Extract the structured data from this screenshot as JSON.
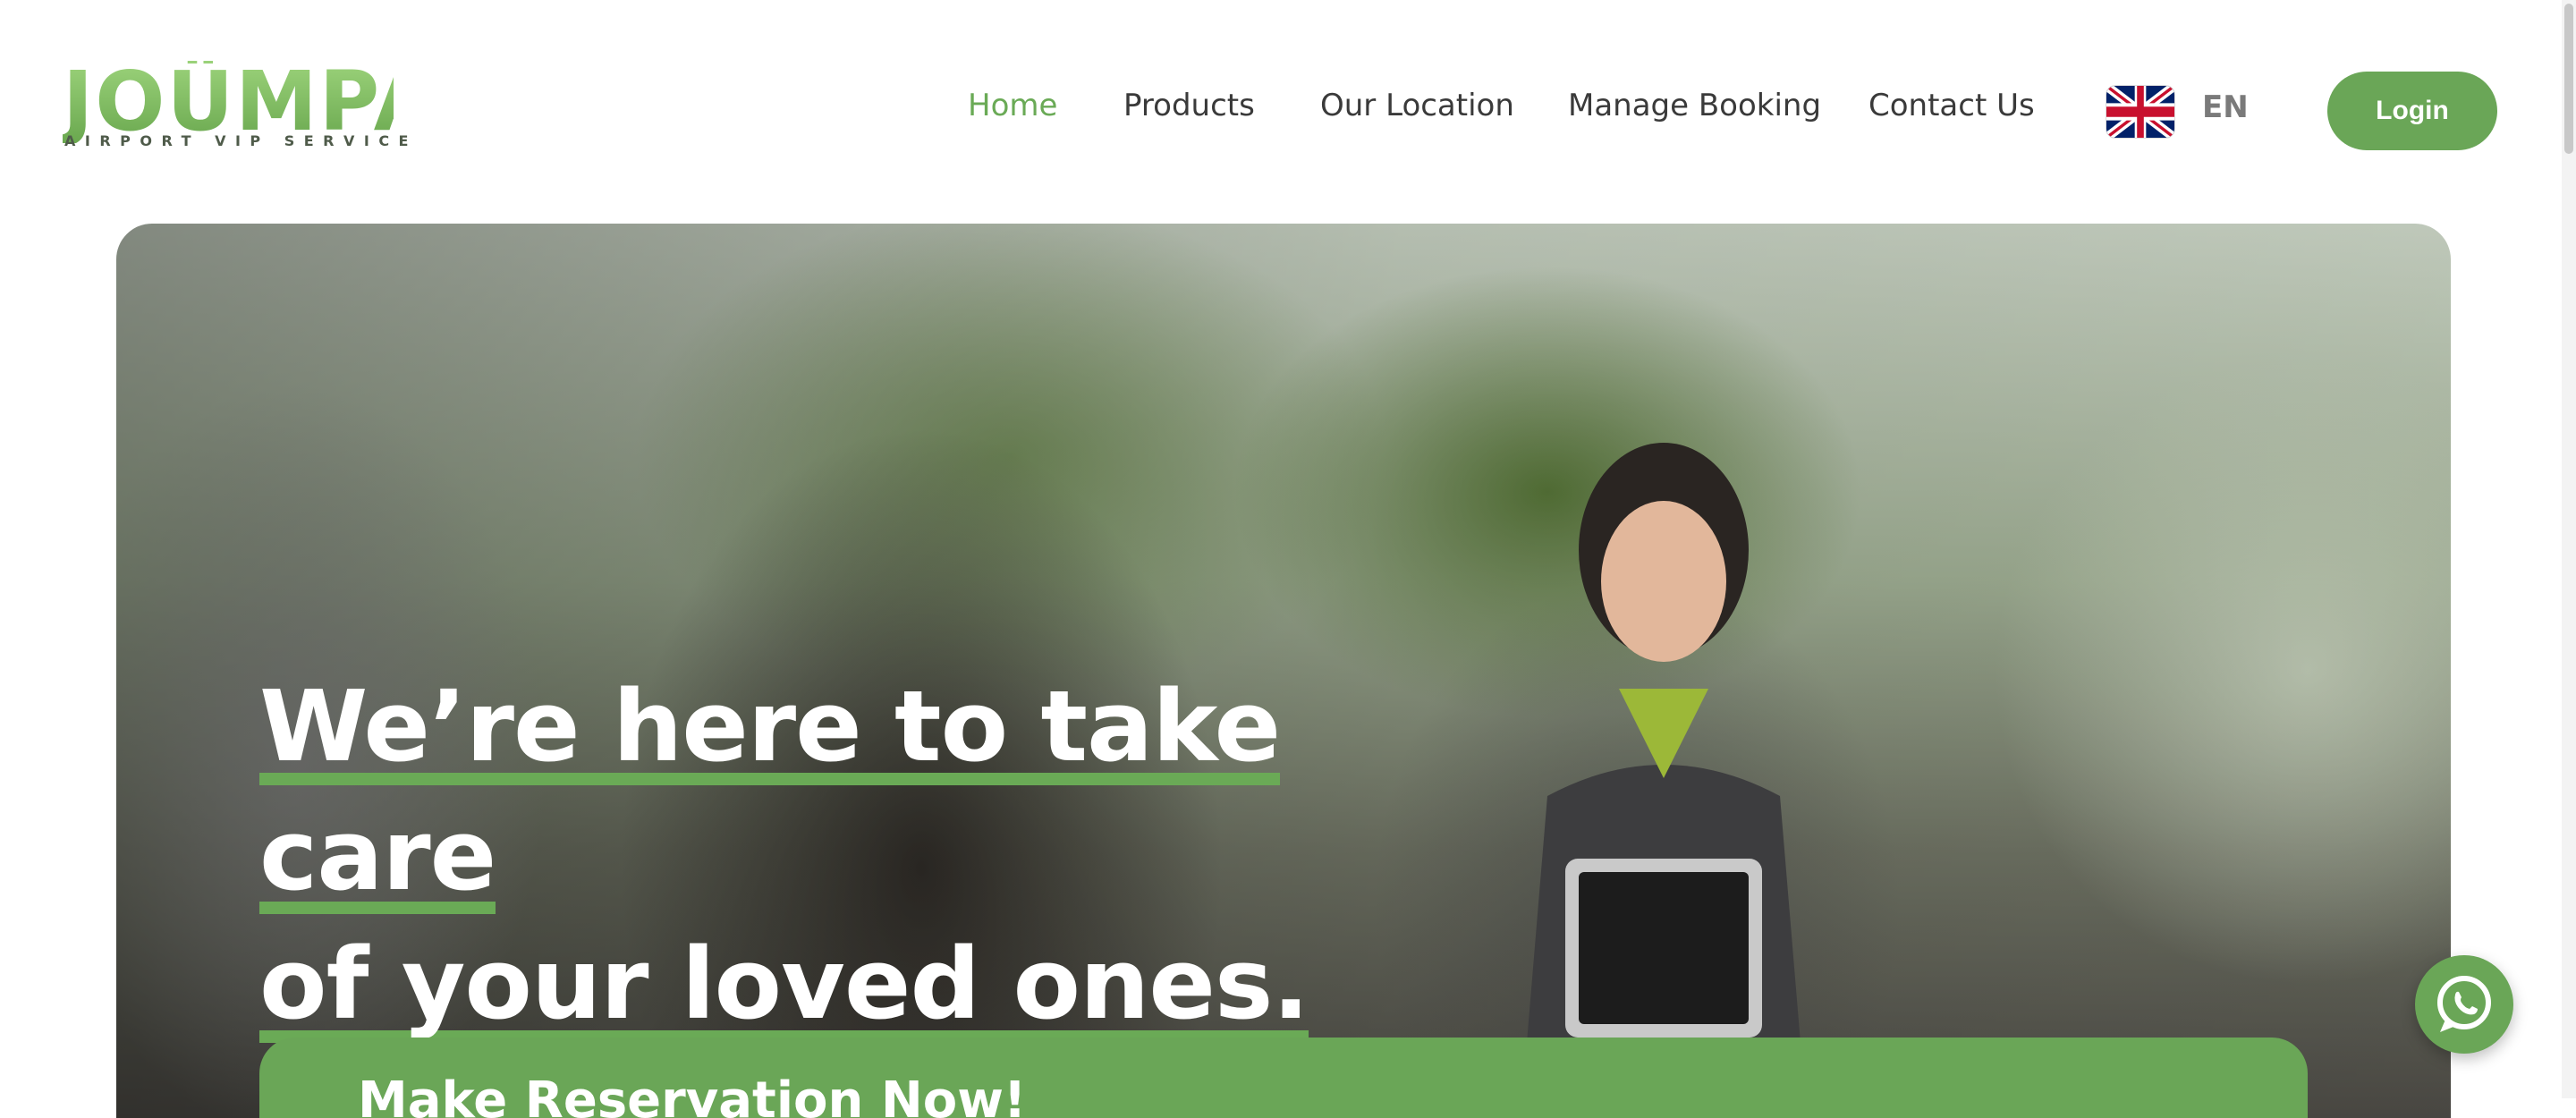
{
  "logo": {
    "wordmark": "JOÜMPA",
    "tagline": "AIRPORT VIP SERVICE"
  },
  "nav": {
    "items": [
      {
        "label": "Home",
        "active": true
      },
      {
        "label": "Products",
        "active": false
      },
      {
        "label": "Our Location",
        "active": false
      },
      {
        "label": "Manage Booking",
        "active": false
      },
      {
        "label": "Contact Us",
        "active": false
      }
    ]
  },
  "language": {
    "code": "EN",
    "flag_icon": "uk-flag-icon"
  },
  "login_label": "Login",
  "hero": {
    "headline_line1": "We’re here to take care",
    "headline_line2": "of your loved ones.",
    "reservation_label": "Make Reservation Now!"
  },
  "colors": {
    "brand_green": "#6aa657",
    "active_nav": "#6aaa56",
    "text": "#3a3a3a"
  },
  "floating": {
    "icon": "whatsapp-icon"
  }
}
